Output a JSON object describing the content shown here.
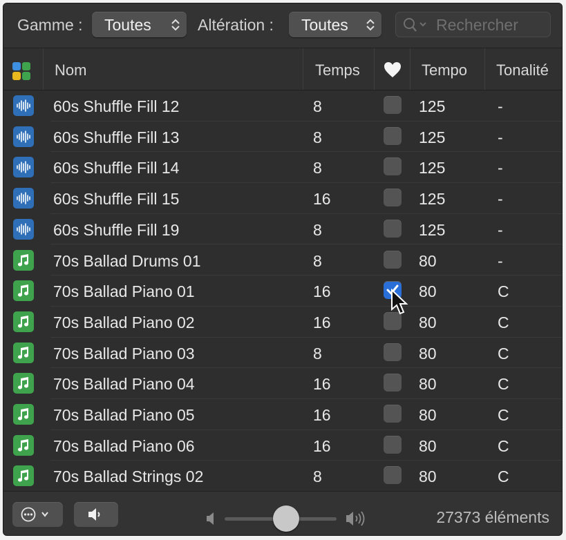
{
  "filters": {
    "scale_label": "Gamme :",
    "scale_value": "Toutes",
    "alteration_label": "Altération :",
    "alteration_value": "Toutes",
    "search_placeholder": "Rechercher"
  },
  "columns": {
    "type_icon": "grid-color-icon",
    "name": "Nom",
    "beats": "Temps",
    "favorite_icon": "heart-icon",
    "tempo": "Tempo",
    "key": "Tonalité"
  },
  "rows": [
    {
      "type": "audio",
      "name": "60s Shuffle Fill 12",
      "beats": "8",
      "favorite": false,
      "tempo": "125",
      "key": "-"
    },
    {
      "type": "audio",
      "name": "60s Shuffle Fill 13",
      "beats": "8",
      "favorite": false,
      "tempo": "125",
      "key": "-"
    },
    {
      "type": "audio",
      "name": "60s Shuffle Fill 14",
      "beats": "8",
      "favorite": false,
      "tempo": "125",
      "key": "-"
    },
    {
      "type": "audio",
      "name": "60s Shuffle Fill 15",
      "beats": "16",
      "favorite": false,
      "tempo": "125",
      "key": "-"
    },
    {
      "type": "audio",
      "name": "60s Shuffle Fill 19",
      "beats": "8",
      "favorite": false,
      "tempo": "125",
      "key": "-"
    },
    {
      "type": "midi",
      "name": "70s Ballad Drums 01",
      "beats": "8",
      "favorite": false,
      "tempo": "80",
      "key": "-"
    },
    {
      "type": "midi",
      "name": "70s Ballad Piano 01",
      "beats": "16",
      "favorite": true,
      "tempo": "80",
      "key": "C"
    },
    {
      "type": "midi",
      "name": "70s Ballad Piano 02",
      "beats": "16",
      "favorite": false,
      "tempo": "80",
      "key": "C"
    },
    {
      "type": "midi",
      "name": "70s Ballad Piano 03",
      "beats": "8",
      "favorite": false,
      "tempo": "80",
      "key": "C"
    },
    {
      "type": "midi",
      "name": "70s Ballad Piano 04",
      "beats": "16",
      "favorite": false,
      "tempo": "80",
      "key": "C"
    },
    {
      "type": "midi",
      "name": "70s Ballad Piano 05",
      "beats": "16",
      "favorite": false,
      "tempo": "80",
      "key": "C"
    },
    {
      "type": "midi",
      "name": "70s Ballad Piano 06",
      "beats": "16",
      "favorite": false,
      "tempo": "80",
      "key": "C"
    },
    {
      "type": "midi",
      "name": "70s Ballad Strings 02",
      "beats": "8",
      "favorite": false,
      "tempo": "80",
      "key": "C"
    }
  ],
  "footer": {
    "more_icon": "ellipsis-circle-icon",
    "speaker_icon": "speaker-icon",
    "volume_level": 0.55,
    "item_count": "27373 éléments"
  },
  "colors": {
    "audio_icon": "#2e6fb7",
    "midi_icon": "#3fa34d",
    "checked": "#2a6ed8"
  }
}
